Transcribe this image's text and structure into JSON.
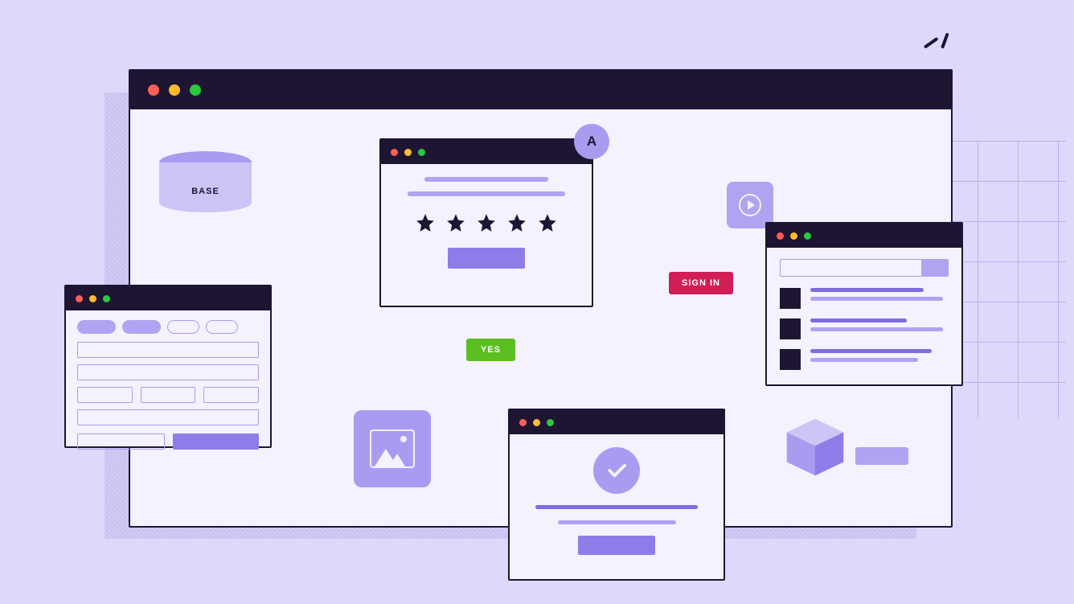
{
  "database": {
    "label": "BASE"
  },
  "avatar_badge": {
    "letter": "A"
  },
  "decision": {
    "yes_label": "YES"
  },
  "action": {
    "signin_label": "SIGN IN"
  },
  "rating": {
    "star_count": 5
  }
}
